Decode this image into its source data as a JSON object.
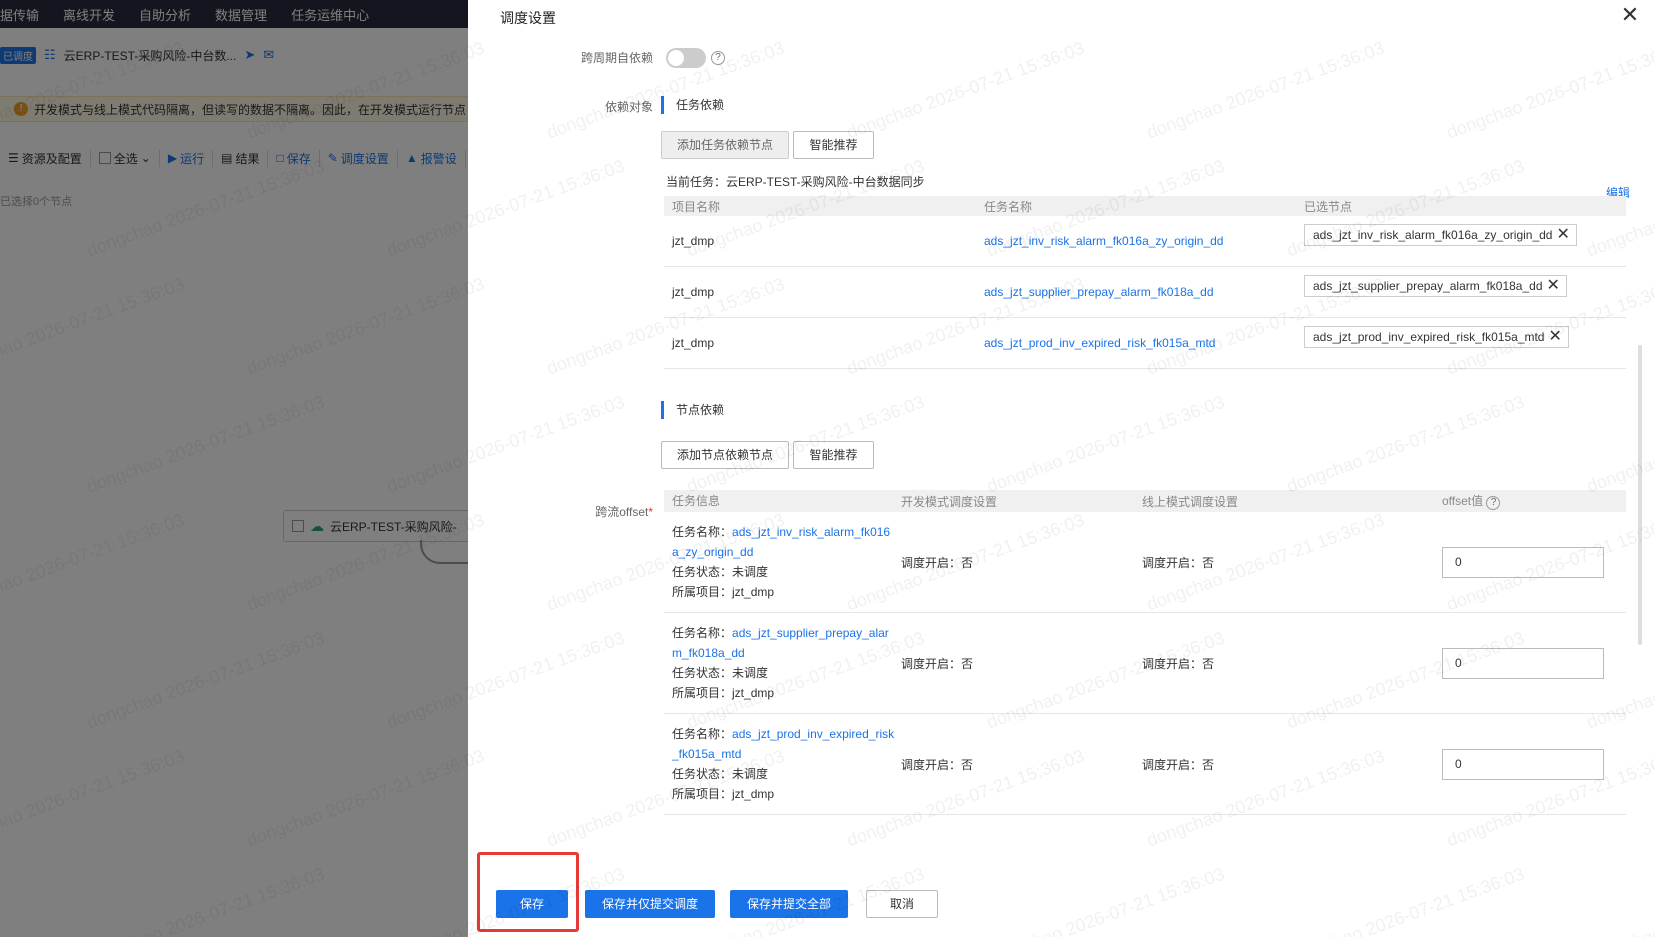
{
  "background": {
    "nav": [
      "据传输",
      "离线开发",
      "自助分析",
      "数据管理",
      "任务运维中心"
    ],
    "task_tag": "已调度",
    "task_name": "云ERP-TEST-采购风险-中台数...",
    "warning": "开发模式与线上模式代码隔离，但读写的数据不隔离。因此，在开发模式运行节点",
    "toolbar": {
      "resources": "资源及配置",
      "select_all": "全选",
      "run": "运行",
      "result": "结果",
      "save": "保存",
      "schedule": "调度设置",
      "alert": "报警设"
    },
    "selected_info": "已选择0个节点",
    "node_label": "云ERP-TEST-采购风险-"
  },
  "drawer": {
    "title": "调度设置",
    "cross_cycle_label": "跨周期自依赖",
    "dep_object_label": "依赖对象",
    "task_dep_title": "任务依赖",
    "add_task_dep": "添加任务依赖节点",
    "smart_recommend": "智能推荐",
    "current_task": "当前任务：云ERP-TEST-采购风险-中台数据同步",
    "edit": "编辑",
    "dep_table": {
      "headers": [
        "项目名称",
        "任务名称",
        "已选节点"
      ],
      "rows": [
        {
          "project": "jzt_dmp",
          "task": "ads_jzt_inv_risk_alarm_fk016a_zy_origin_dd",
          "selected": "ads_jzt_inv_risk_alarm_fk016a_zy_origin_dd"
        },
        {
          "project": "jzt_dmp",
          "task": "ads_jzt_supplier_prepay_alarm_fk018a_dd",
          "selected": "ads_jzt_supplier_prepay_alarm_fk018a_dd"
        },
        {
          "project": "jzt_dmp",
          "task": "ads_jzt_prod_inv_expired_risk_fk015a_mtd",
          "selected": "ads_jzt_prod_inv_expired_risk_fk015a_mtd"
        }
      ]
    },
    "node_dep_title": "节点依赖",
    "add_node_dep": "添加节点依赖节点",
    "cross_offset_label": "跨流offset",
    "required_mark": "*",
    "offset_table": {
      "headers": [
        "任务信息",
        "开发模式调度设置",
        "线上模式调度设置",
        "offset值"
      ],
      "name_label": "任务名称：",
      "status_label": "任务状态：",
      "project_label": "所属项目：",
      "rows": [
        {
          "name_a": "ads_jzt_inv_risk_alarm_fk016",
          "name_b": "a_zy_origin_dd",
          "status": "未调度",
          "project": "jzt_dmp",
          "dev": "调度开启：否",
          "online": "调度开启：否",
          "offset": "0"
        },
        {
          "name_a": "ads_jzt_supplier_prepay_alar",
          "name_b": "m_fk018a_dd",
          "status": "未调度",
          "project": "jzt_dmp",
          "dev": "调度开启：否",
          "online": "调度开启：否",
          "offset": "0"
        },
        {
          "name_a": "ads_jzt_prod_inv_expired_risk",
          "name_b": "_fk015a_mtd",
          "status": "未调度",
          "project": "jzt_dmp",
          "dev": "调度开启：否",
          "online": "调度开启：否",
          "offset": "0"
        }
      ]
    },
    "footer": {
      "save": "保存",
      "save_submit_schedule": "保存并仅提交调度",
      "save_submit_all": "保存并提交全部",
      "cancel": "取消"
    }
  },
  "watermark": "dongchao 2026-07-21 15:36:03",
  "colors": {
    "accent": "#1a73e8",
    "highlight": "#e53935"
  }
}
